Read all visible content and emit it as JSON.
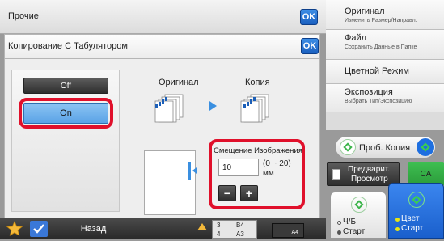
{
  "top_bar": {
    "title": "Прочие",
    "ok_label": "OK"
  },
  "dialog": {
    "title": "Копирование С Табулятором",
    "ok_label": "OK"
  },
  "toggle": {
    "off_label": "Off",
    "on_label": "On",
    "selected": "On"
  },
  "diagram": {
    "original_label": "Оригинал",
    "copy_label": "Копия"
  },
  "shift": {
    "title": "Смещение Изображения",
    "value": "10",
    "range": "(0 ~ 20)",
    "unit": "мм",
    "minus": "−",
    "plus": "+"
  },
  "right_panel": {
    "items": [
      {
        "main": "Оригинал",
        "sub": "Изменить Размер/Направл."
      },
      {
        "main": "Файл",
        "sub": "Сохранить Данные в Папке"
      },
      {
        "main": "Цветной Режим",
        "sub": ""
      },
      {
        "main": "Экспозиция",
        "sub": "Выбрать Тип/Экспозицию"
      }
    ],
    "proof_copy": "Проб. Копия",
    "preview_line1": "Предварит.",
    "preview_line2": "Просмотр",
    "ca": "CA",
    "bw_line1": "Ч/Б",
    "bw_line2": "Старт",
    "color_line1": "Цвет",
    "color_line2": "Старт"
  },
  "bottom_bar": {
    "back": "Назад",
    "trays": [
      {
        "num": "3",
        "size": "B4"
      },
      {
        "num": "4",
        "size": "A3"
      }
    ],
    "paper_tag": "A4"
  },
  "colors": {
    "accent_red": "#e0102b",
    "ok_blue": "#1a5fbf",
    "start_blue": "#1e6fe0",
    "green": "#3bb54a"
  }
}
